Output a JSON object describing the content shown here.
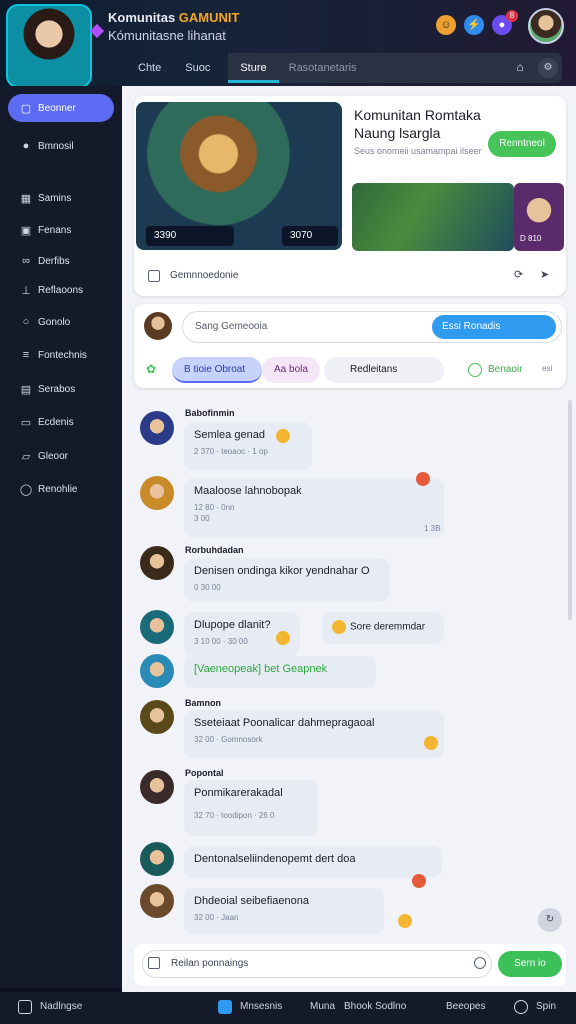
{
  "header": {
    "brand_line1_prefix": "Komunitas",
    "brand_line1_highlight": "GAMUNIT",
    "brand_line2": "Kómunitasne lihanat",
    "notification_badge": "8",
    "tabs": [
      {
        "label": "Chte"
      },
      {
        "label": "Suoc"
      },
      {
        "label": "Sture"
      }
    ],
    "search_placeholder": "Rasotanetaris"
  },
  "sidebar": {
    "items": [
      {
        "label": "Beonner",
        "icon": "chat-icon"
      },
      {
        "label": "Bmnosil",
        "icon": "dot-icon"
      },
      {
        "label": "Samins",
        "icon": "grid-icon"
      },
      {
        "label": "Fenans",
        "icon": "calendar-icon"
      },
      {
        "label": "Derfibs",
        "icon": "link-icon"
      },
      {
        "label": "Reflaoons",
        "icon": "chart-icon"
      },
      {
        "label": "Gonolo",
        "icon": "search-icon"
      },
      {
        "label": "Fontechnis",
        "icon": "list-icon"
      },
      {
        "label": "Serabos",
        "icon": "book-icon"
      },
      {
        "label": "Ecdenis",
        "icon": "doc-icon"
      },
      {
        "label": "Gleoor",
        "icon": "folder-icon"
      },
      {
        "label": "Renohlie",
        "icon": "circle-icon"
      }
    ]
  },
  "hero": {
    "badge_left": "3390",
    "badge_right": "3070",
    "title": "Komunitan Romtaka Naung lsargla",
    "description": "Seus onomeii usamampai ilseer",
    "cta": "Renntneol",
    "thumb_label": "D 810",
    "footer_label": "Gemnnoedonie"
  },
  "composer": {
    "placeholder": "Sang Gemeooia",
    "send": "Essi Ronadis",
    "chips": [
      {
        "label": "B tioie Obroat"
      },
      {
        "label": "Aa bola"
      },
      {
        "label": "Redleitans"
      },
      {
        "label": "Benaoir"
      }
    ],
    "chip_extra": "esi"
  },
  "messages": [
    {
      "name": "Babofinmin",
      "text": "Semlea genad",
      "meta": "2 370 · teoaoc · 1 op"
    },
    {
      "name": "",
      "text": "Maaloose lahnobopak",
      "meta": "12 80 · 0nn",
      "meta2": "3 00"
    },
    {
      "name": "Rorbuhdadan",
      "text": "Denisen ondinga kikor yendnahar O",
      "meta": "0 30 00"
    },
    {
      "name": "",
      "text": "Dlupope dlanit?",
      "meta": "3 10 00 · 30 00"
    },
    {
      "name": "",
      "text": "[Vaeneopeak] bet Geapnek",
      "meta": ""
    },
    {
      "name": "Bamnon",
      "text": "Sseteiaat Poonalicar dahmepragaoal",
      "meta": "32 00 · Gomnosork"
    },
    {
      "name": "Popontal",
      "text": "Ponmikarerakadal",
      "meta": "32 70 · toodipon · 26 0"
    },
    {
      "name": "",
      "text": "Dentonalseliindenopemt dert doa",
      "meta": ""
    },
    {
      "name": "",
      "text": "Dhdeoial seibefiaenona",
      "meta": "32 00 · Jaan"
    }
  ],
  "side_bubble": "Sore deremmdar",
  "reactions": [
    "1 3B"
  ],
  "input": {
    "placeholder": "Reilan ponnaings",
    "send": "Sern io"
  },
  "bottombar": [
    "Nadlngse",
    "Mnsesnis",
    "Muna",
    "Bhook Sodlno",
    "Beeopes",
    "Spin"
  ]
}
